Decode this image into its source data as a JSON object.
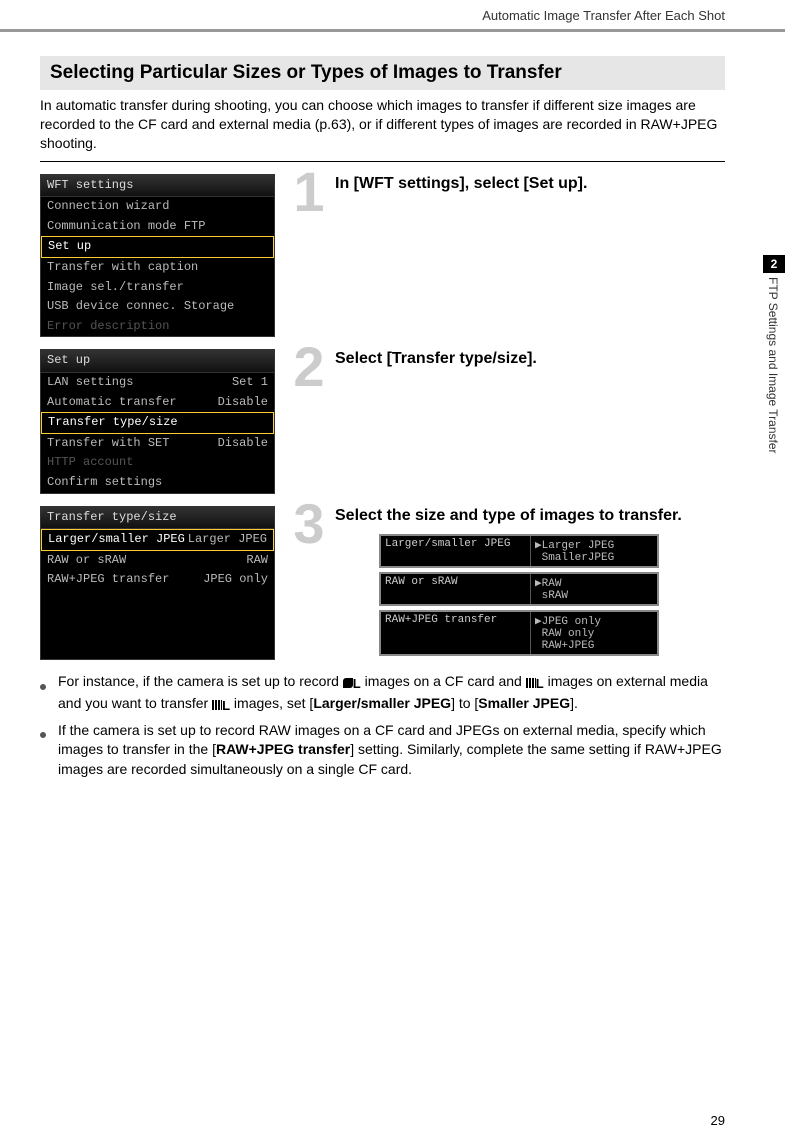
{
  "running_head": "Automatic Image Transfer After Each Shot",
  "section_title": "Selecting Particular Sizes or Types of Images to Transfer",
  "intro": "In automatic transfer during shooting, you can choose which images to transfer if different size images are recorded to the CF card and external media (p.63), or if different types of images are recorded in RAW+JPEG shooting.",
  "steps": [
    {
      "num": "1",
      "heading": "In [WFT settings], select [Set up].",
      "menu": {
        "title": "WFT settings",
        "rows": [
          {
            "text": "Connection wizard",
            "sel": false
          },
          {
            "text": "Communication mode FTP",
            "sel": false
          },
          {
            "text": "Set up",
            "sel": true
          },
          {
            "text": "Transfer with caption",
            "sel": false
          },
          {
            "text": "Image sel./transfer",
            "sel": false
          },
          {
            "text": "USB device connec. Storage",
            "sel": false
          },
          {
            "text": "Error description",
            "sel": false,
            "dim": true
          }
        ]
      }
    },
    {
      "num": "2",
      "heading": "Select [Transfer type/size].",
      "menu": {
        "title": "Set up",
        "rows2": [
          {
            "l": "LAN settings",
            "r": "Set 1",
            "sel": false
          },
          {
            "l": "Automatic transfer",
            "r": "Disable",
            "sel": false
          },
          {
            "l": "Transfer type/size",
            "r": "",
            "sel": true
          },
          {
            "l": "Transfer with SET",
            "r": "Disable",
            "sel": false
          },
          {
            "l": "HTTP account",
            "r": "",
            "sel": false,
            "dim": true
          },
          {
            "l": "Confirm settings",
            "r": "",
            "sel": false
          }
        ]
      }
    },
    {
      "num": "3",
      "heading": "Select the size and type of images to transfer.",
      "menu": {
        "title": "Transfer type/size",
        "rows2": [
          {
            "l": "Larger/smaller JPEG",
            "r": "Larger JPEG",
            "sel": true
          },
          {
            "l": "RAW or sRAW",
            "r": "RAW",
            "sel": false
          },
          {
            "l": "RAW+JPEG transfer",
            "r": "JPEG only",
            "sel": false
          }
        ]
      },
      "popouts": [
        {
          "label": "Larger/smaller JPEG",
          "opts": [
            "Larger JPEG",
            "SmallerJPEG"
          ],
          "selIndex": 0
        },
        {
          "label": "RAW or sRAW",
          "opts": [
            "RAW",
            "sRAW"
          ],
          "selIndex": 0
        },
        {
          "label": "RAW+JPEG transfer",
          "opts": [
            "JPEG only",
            "RAW only",
            "RAW+JPEG"
          ],
          "selIndex": 0
        }
      ]
    }
  ],
  "bullets": [
    {
      "parts": [
        {
          "t": "For instance, if the camera is set up to record "
        },
        {
          "icon": "smooth-L"
        },
        {
          "t": " images on a CF card and "
        },
        {
          "icon": "stripe-L"
        },
        {
          "t": " images on external media and you want to transfer "
        },
        {
          "icon": "stripe-L"
        },
        {
          "t": " images, set ["
        },
        {
          "t": "Larger/smaller JPEG",
          "bold": true
        },
        {
          "t": "] to ["
        },
        {
          "t": "Smaller JPEG",
          "bold": true
        },
        {
          "t": "]."
        }
      ]
    },
    {
      "parts": [
        {
          "t": "If the camera is set up to record RAW images on a CF card and JPEGs on external media, specify which images to transfer in the ["
        },
        {
          "t": "RAW+JPEG transfer",
          "bold": true
        },
        {
          "t": "] setting. Similarly, complete the same setting if RAW+JPEG images are recorded simultaneously on a single CF card."
        }
      ]
    }
  ],
  "side_tab": {
    "num": "2",
    "label": "FTP Settings and Image Transfer"
  },
  "page_number": "29"
}
